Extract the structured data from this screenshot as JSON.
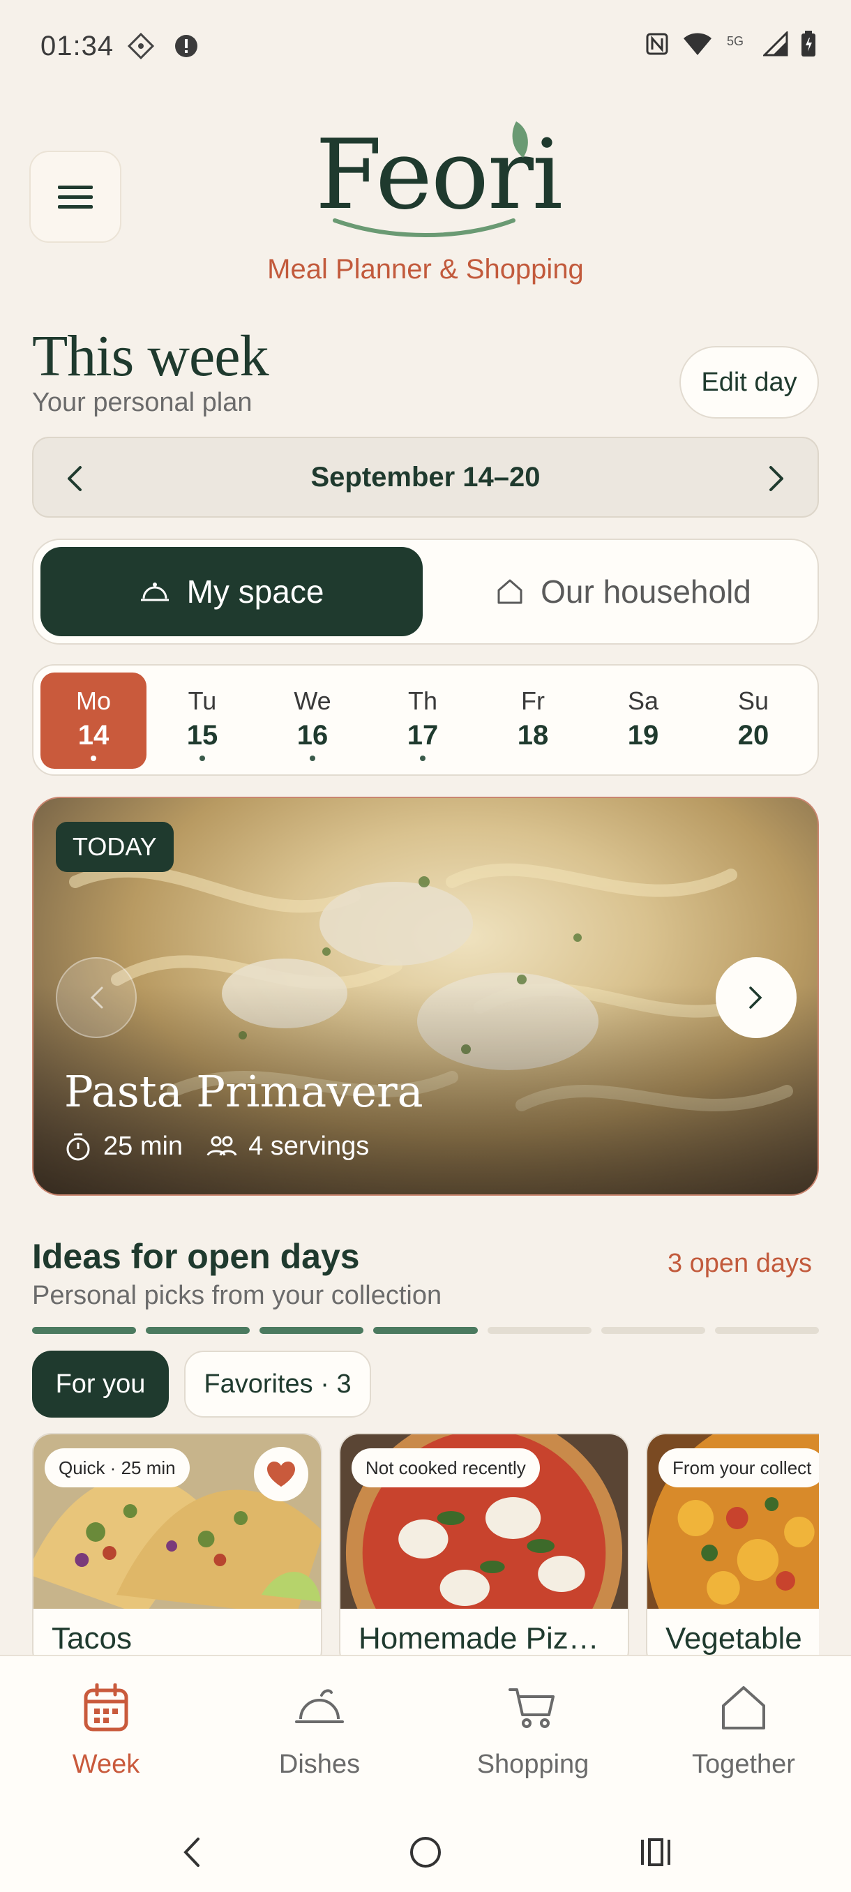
{
  "status_bar": {
    "time": "01:34",
    "icons_left": [
      "photo-icon",
      "alert-icon"
    ],
    "icons_right": [
      "nfc-icon",
      "wifi-icon",
      "5g-icon",
      "signal-icon",
      "battery-icon"
    ]
  },
  "header": {
    "brand": "Feori",
    "tagline": "Meal Planner & Shopping",
    "menu_icon": "hamburger-icon"
  },
  "week": {
    "title": "This week",
    "subtitle": "Your personal plan",
    "edit_button": "Edit day",
    "range": "September 14–20"
  },
  "segments": {
    "active": "My space",
    "inactive": "Our household"
  },
  "days": [
    {
      "name": "Mo",
      "date": "14",
      "dot": true,
      "active": true
    },
    {
      "name": "Tu",
      "date": "15",
      "dot": true,
      "active": false
    },
    {
      "name": "We",
      "date": "16",
      "dot": true,
      "active": false
    },
    {
      "name": "Th",
      "date": "17",
      "dot": true,
      "active": false
    },
    {
      "name": "Fr",
      "date": "18",
      "dot": false,
      "active": false
    },
    {
      "name": "Sa",
      "date": "19",
      "dot": false,
      "active": false
    },
    {
      "name": "Su",
      "date": "20",
      "dot": false,
      "active": false
    }
  ],
  "hero": {
    "badge": "TODAY",
    "title": "Pasta Primavera",
    "time": "25 min",
    "servings": "4 servings"
  },
  "ideas": {
    "title": "Ideas for open days",
    "subtitle": "Personal picks from your collection",
    "open_count": "3 open days",
    "progress_filled": 4,
    "progress_total": 7,
    "chips": {
      "for_you": "For you",
      "favorites": "Favorites · 3"
    },
    "cards": [
      {
        "tag": "Quick · 25 min",
        "name": "Tacos",
        "favorite": true
      },
      {
        "tag": "Not cooked recently",
        "name": "Homemade Piz…",
        "favorite": false
      },
      {
        "tag": "From your collect",
        "name": "Vegetable",
        "favorite": false
      }
    ]
  },
  "bottom_nav": [
    {
      "label": "Week",
      "icon": "calendar-icon",
      "active": true
    },
    {
      "label": "Dishes",
      "icon": "cloche-icon",
      "active": false
    },
    {
      "label": "Shopping",
      "icon": "cart-icon",
      "active": false
    },
    {
      "label": "Together",
      "icon": "home-icon",
      "active": false
    }
  ],
  "colors": {
    "background": "#f6f1ea",
    "primary": "#1f3a2e",
    "accent": "#c95a3c"
  }
}
